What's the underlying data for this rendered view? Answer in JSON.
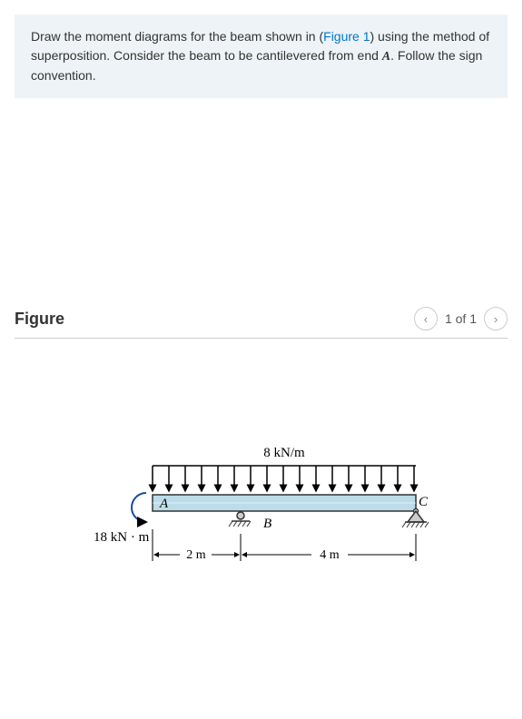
{
  "problem": {
    "text_before": "Draw the moment diagrams for the beam shown in (",
    "figref": "Figure 1",
    "text_mid1": ") using the method of superposition. Consider the beam to be cantilevered from end ",
    "mathvar": "A",
    "text_after": ". Follow the sign convention."
  },
  "figure": {
    "heading": "Figure",
    "pager_count": "1 of 1",
    "diagram": {
      "dist_load_label": "8 kN/m",
      "moment_label": "18 kN · m",
      "point_A": "A",
      "point_B": "B",
      "point_C": "C",
      "dim_left": "2 m",
      "dim_right": "4 m"
    }
  }
}
